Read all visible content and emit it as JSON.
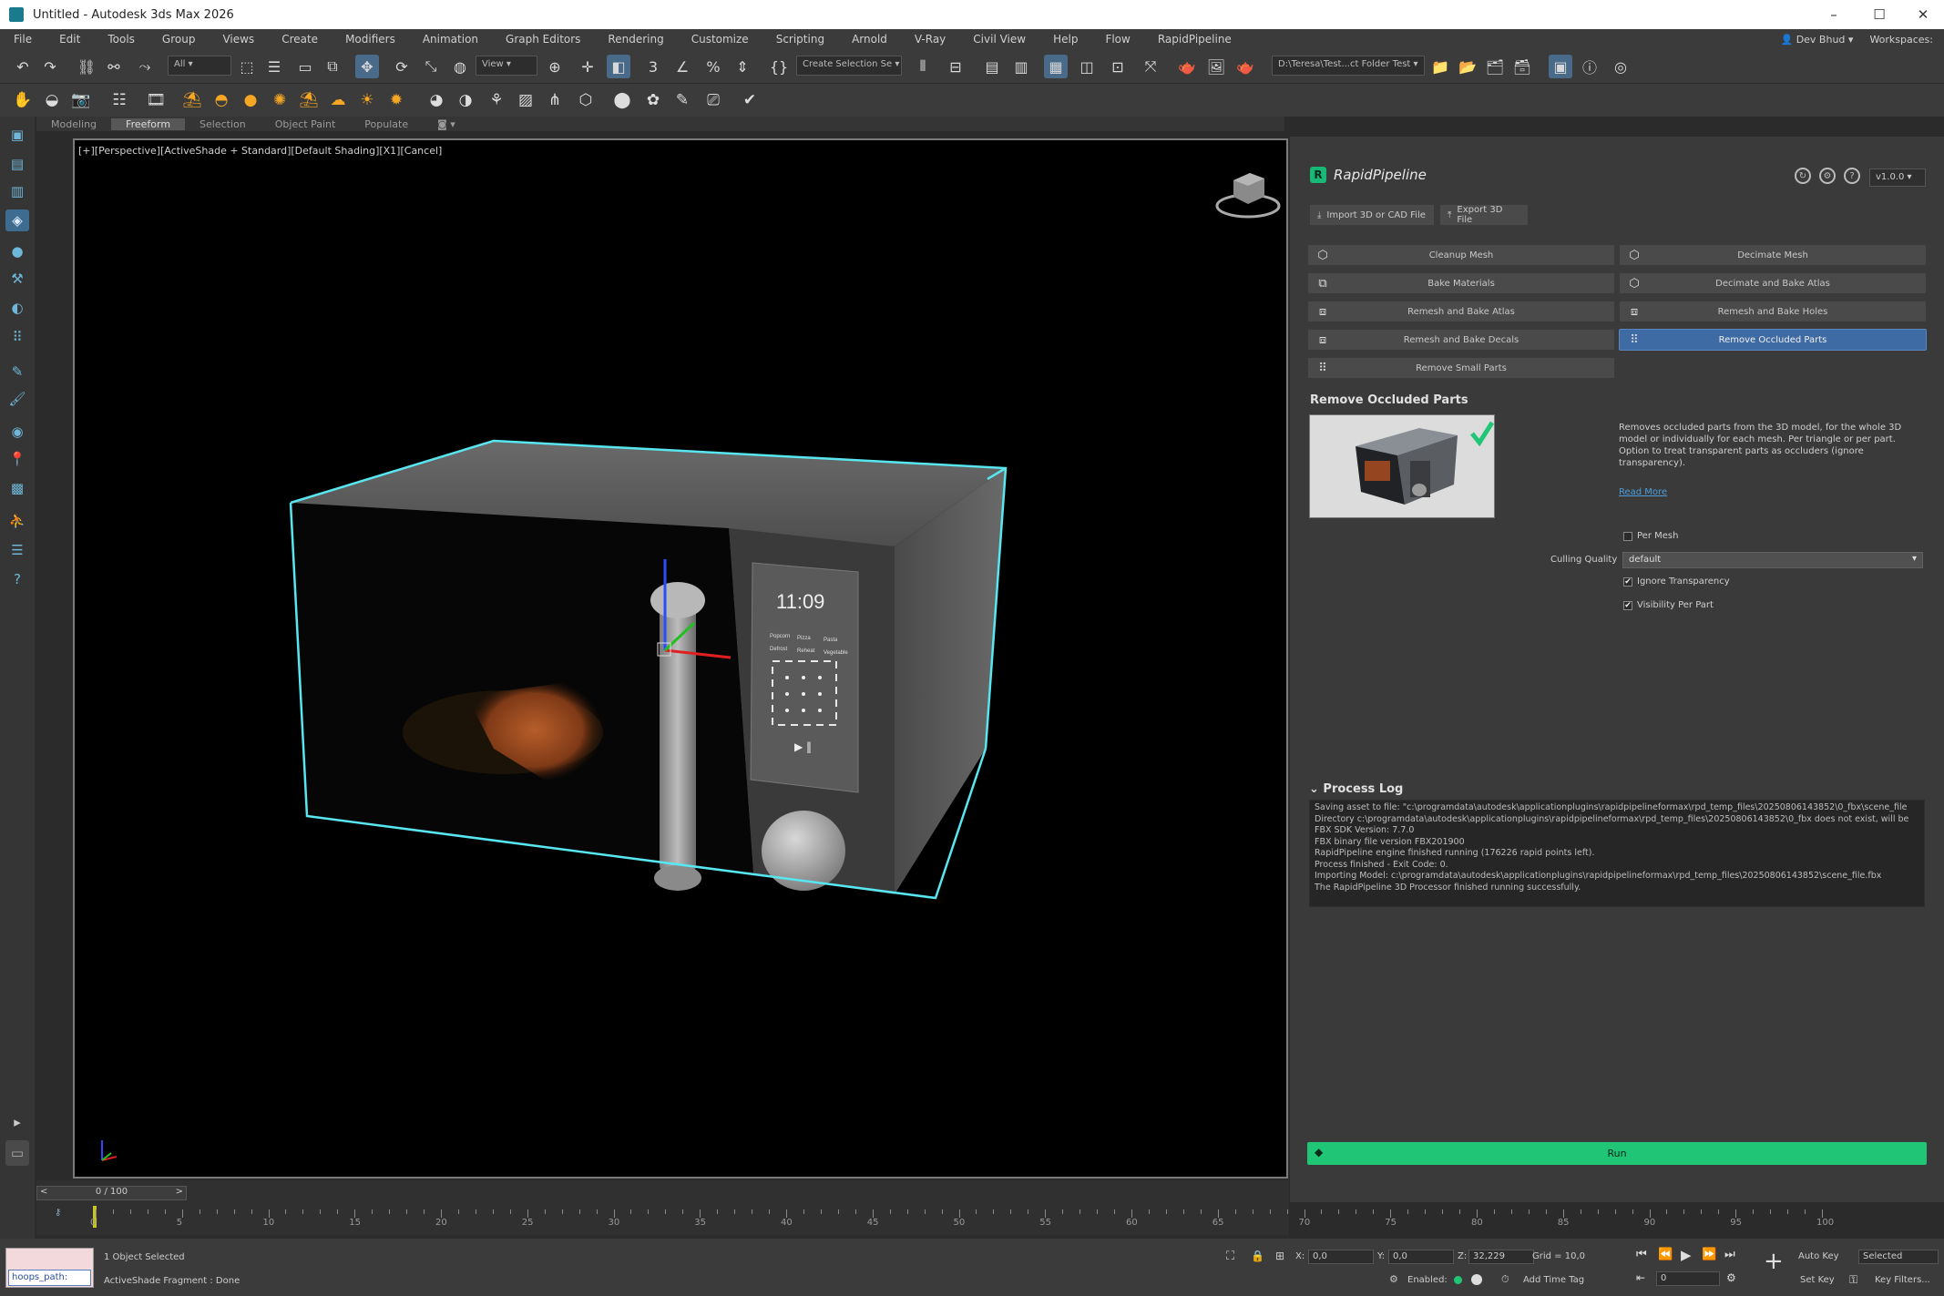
{
  "window": {
    "title": "Untitled - Autodesk 3ds Max 2026"
  },
  "menu": {
    "items": [
      "File",
      "Edit",
      "Tools",
      "Group",
      "Views",
      "Create",
      "Modifiers",
      "Animation",
      "Graph Editors",
      "Rendering",
      "Customize",
      "Scripting",
      "Arnold",
      "V-Ray",
      "Civil View",
      "Help",
      "Flow",
      "RapidPipeline"
    ],
    "user": "Dev Bhud",
    "workspace": "Workspaces:"
  },
  "toolbar": {
    "selection_filter": "All",
    "ref_coord": "View",
    "named_selection": "Create Selection Se",
    "path": "D:\\Teresa\\Test...ct Folder Test"
  },
  "ribbon": {
    "tabs": [
      "Modeling",
      "Freeform",
      "Selection",
      "Object Paint",
      "Populate"
    ]
  },
  "viewport": {
    "label": "[+][Perspective][ActiveShade + Standard][Default Shading][X1][Cancel]",
    "display_time": "11:09",
    "button_labels": [
      [
        "Popcorn",
        "Pizza",
        "Pasta"
      ],
      [
        "Defrost",
        "Reheat",
        "Vegetable"
      ]
    ],
    "playbar": "▶ ‖"
  },
  "panel": {
    "plugin_name": "RapidPipeline",
    "version": "v1.0.0",
    "import_label": "Import 3D or CAD File",
    "export_label": "Export 3D File",
    "buttons": {
      "cleanup": "Cleanup Mesh",
      "decimate": "Decimate Mesh",
      "bake_materials": "Bake Materials",
      "decimate_bake": "Decimate and Bake Atlas",
      "remesh_atlas": "Remesh and Bake Atlas",
      "remesh_holes": "Remesh and Bake Holes",
      "remesh_decals": "Remesh and Bake Decals",
      "remove_occluded": "Remove Occluded Parts",
      "remove_small": "Remove Small Parts"
    },
    "section_title": "Remove Occluded Parts",
    "description": "Removes occluded parts from the 3D model, for the whole 3D model or individually for each mesh. Per triangle or per part. Option to treat transparent parts as occluders (ignore transparency).",
    "read_more": "Read More",
    "options": {
      "per_mesh": "Per Mesh",
      "culling_quality_label": "Culling Quality",
      "culling_quality_value": "default",
      "ignore_transparency": "Ignore Transparency",
      "visibility_per_part": "Visibility Per Part"
    },
    "process_log_title": "Process Log",
    "process_log": [
      "Saving asset to file: \"c:\\programdata\\autodesk\\applicationplugins\\rapidpipelineformax\\rpd_temp_files\\20250806143852\\0_fbx\\scene_file",
      "Directory c:\\programdata\\autodesk\\applicationplugins\\rapidpipelineformax\\rpd_temp_files\\20250806143852\\0_fbx does not exist, will be",
      "FBX SDK Version: 7.7.0",
      "FBX binary file version FBX201900",
      "RapidPipeline engine finished running (176226 rapid points left).",
      "Process finished - Exit Code: 0.",
      "Importing Model: c:\\programdata\\autodesk\\applicationplugins\\rapidpipelineformax\\rpd_temp_files\\20250806143852\\scene_file.fbx",
      "The RapidPipeline 3D Processor finished running successfully."
    ],
    "run_label": "Run"
  },
  "timeline": {
    "frame": "0 / 100",
    "ticks": [
      "0",
      "5",
      "10",
      "15",
      "20",
      "25",
      "30",
      "35",
      "40",
      "45",
      "50",
      "55",
      "60",
      "65",
      "70",
      "75",
      "80",
      "85",
      "90",
      "95",
      "100"
    ]
  },
  "status": {
    "maxscript": "hoops_path:",
    "selected": "1 Object Selected",
    "message": "ActiveShade Fragment : Done",
    "x": "0,0",
    "y": "0,0",
    "z": "32,229",
    "grid": "Grid = 10,0",
    "enabled": "Enabled:",
    "add_time_tag": "Add Time Tag",
    "auto_key": "Auto Key",
    "selected_dd": "Selected",
    "set_key": "Set Key",
    "key_filters": "Key Filters...",
    "frame_field": "0"
  },
  "colors": {
    "accent_green": "#21c576",
    "selection_cyan": "#58e6f0",
    "selected_button": "#3f6ba4"
  }
}
